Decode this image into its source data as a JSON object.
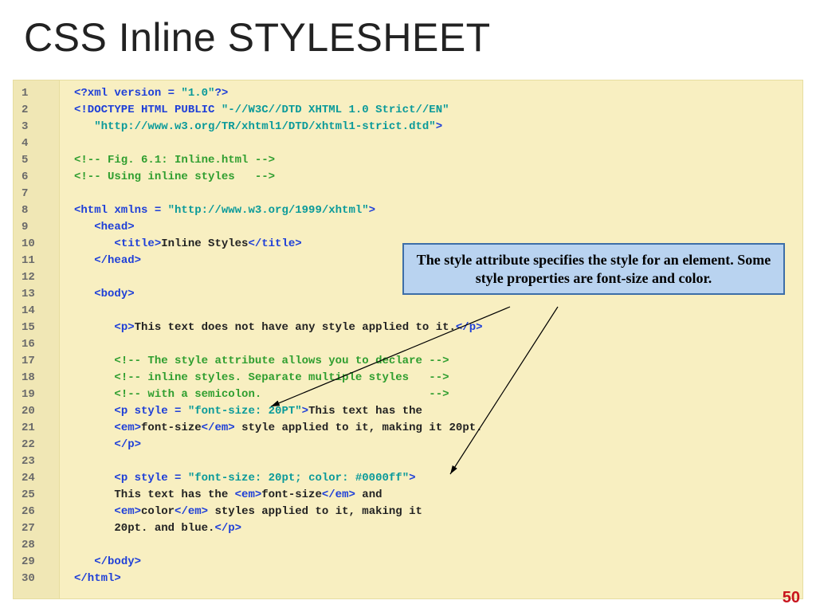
{
  "title": "CSS   Inline STYLESHEET",
  "callout": "The style attribute specifies the style for an element. Some style properties are font-size and color.",
  "page_number": "50",
  "code": {
    "lines": [
      {
        "n": "1",
        "segs": [
          {
            "t": "<?xml version = ",
            "c": "blue"
          },
          {
            "t": "\"1.0\"",
            "c": "str"
          },
          {
            "t": "?>",
            "c": "blue"
          }
        ]
      },
      {
        "n": "2",
        "segs": [
          {
            "t": "<!DOCTYPE HTML PUBLIC ",
            "c": "blue"
          },
          {
            "t": "\"-//W3C//DTD XHTML 1.0 Strict//EN\"",
            "c": "str"
          }
        ]
      },
      {
        "n": "3",
        "segs": [
          {
            "t": "   ",
            "c": ""
          },
          {
            "t": "\"http://www.w3.org/TR/xhtml1/DTD/xhtml1-strict.dtd\"",
            "c": "str"
          },
          {
            "t": ">",
            "c": "blue"
          }
        ]
      },
      {
        "n": "4",
        "segs": [
          {
            "t": "",
            "c": ""
          }
        ]
      },
      {
        "n": "5",
        "segs": [
          {
            "t": "<!-- Fig. 6.1: Inline.html -->",
            "c": "cmt"
          }
        ]
      },
      {
        "n": "6",
        "segs": [
          {
            "t": "<!-- Using inline styles   -->",
            "c": "cmt"
          }
        ]
      },
      {
        "n": "7",
        "segs": [
          {
            "t": "",
            "c": ""
          }
        ]
      },
      {
        "n": "8",
        "segs": [
          {
            "t": "<html xmlns = ",
            "c": "blue"
          },
          {
            "t": "\"http://www.w3.org/1999/xhtml\"",
            "c": "str"
          },
          {
            "t": ">",
            "c": "blue"
          }
        ]
      },
      {
        "n": "9",
        "segs": [
          {
            "t": "   ",
            "c": ""
          },
          {
            "t": "<head>",
            "c": "blue"
          }
        ]
      },
      {
        "n": "10",
        "segs": [
          {
            "t": "      ",
            "c": ""
          },
          {
            "t": "<title>",
            "c": "blue"
          },
          {
            "t": "Inline Styles",
            "c": ""
          },
          {
            "t": "</title>",
            "c": "blue"
          }
        ]
      },
      {
        "n": "11",
        "segs": [
          {
            "t": "   ",
            "c": ""
          },
          {
            "t": "</head>",
            "c": "blue"
          }
        ]
      },
      {
        "n": "12",
        "segs": [
          {
            "t": "",
            "c": ""
          }
        ]
      },
      {
        "n": "13",
        "segs": [
          {
            "t": "   ",
            "c": ""
          },
          {
            "t": "<body>",
            "c": "blue"
          }
        ]
      },
      {
        "n": "14",
        "segs": [
          {
            "t": "",
            "c": ""
          }
        ]
      },
      {
        "n": "15",
        "segs": [
          {
            "t": "      ",
            "c": ""
          },
          {
            "t": "<p>",
            "c": "blue"
          },
          {
            "t": "This text does not have any style applied to it.",
            "c": ""
          },
          {
            "t": "</p>",
            "c": "blue"
          }
        ]
      },
      {
        "n": "16",
        "segs": [
          {
            "t": "",
            "c": ""
          }
        ]
      },
      {
        "n": "17",
        "segs": [
          {
            "t": "      ",
            "c": ""
          },
          {
            "t": "<!-- The style attribute allows you to declare -->",
            "c": "cmt"
          }
        ]
      },
      {
        "n": "18",
        "segs": [
          {
            "t": "      ",
            "c": ""
          },
          {
            "t": "<!-- inline styles. Separate multiple styles   -->",
            "c": "cmt"
          }
        ]
      },
      {
        "n": "19",
        "segs": [
          {
            "t": "      ",
            "c": ""
          },
          {
            "t": "<!-- with a semicolon.                         -->",
            "c": "cmt"
          }
        ]
      },
      {
        "n": "20",
        "segs": [
          {
            "t": "      ",
            "c": ""
          },
          {
            "t": "<p style = ",
            "c": "blue"
          },
          {
            "t": "\"font-size: 20PT\"",
            "c": "str"
          },
          {
            "t": ">",
            "c": "blue"
          },
          {
            "t": "This text has the",
            "c": ""
          }
        ]
      },
      {
        "n": "21",
        "segs": [
          {
            "t": "      ",
            "c": ""
          },
          {
            "t": "<em>",
            "c": "blue"
          },
          {
            "t": "font-size",
            "c": ""
          },
          {
            "t": "</em>",
            "c": "blue"
          },
          {
            "t": " style applied to it, making it 20pt.",
            "c": ""
          }
        ]
      },
      {
        "n": "22",
        "segs": [
          {
            "t": "      ",
            "c": ""
          },
          {
            "t": "</p>",
            "c": "blue"
          }
        ]
      },
      {
        "n": "23",
        "segs": [
          {
            "t": "",
            "c": ""
          }
        ]
      },
      {
        "n": "24",
        "segs": [
          {
            "t": "      ",
            "c": ""
          },
          {
            "t": "<p style = ",
            "c": "blue"
          },
          {
            "t": "\"font-size: 20pt; color: #0000ff\"",
            "c": "str"
          },
          {
            "t": ">",
            "c": "blue"
          }
        ]
      },
      {
        "n": "25",
        "segs": [
          {
            "t": "      This text has the ",
            "c": ""
          },
          {
            "t": "<em>",
            "c": "blue"
          },
          {
            "t": "font-size",
            "c": ""
          },
          {
            "t": "</em>",
            "c": "blue"
          },
          {
            "t": " and",
            "c": ""
          }
        ]
      },
      {
        "n": "26",
        "segs": [
          {
            "t": "      ",
            "c": ""
          },
          {
            "t": "<em>",
            "c": "blue"
          },
          {
            "t": "color",
            "c": ""
          },
          {
            "t": "</em>",
            "c": "blue"
          },
          {
            "t": " styles applied to it, making it",
            "c": ""
          }
        ]
      },
      {
        "n": "27",
        "segs": [
          {
            "t": "      20pt. and blue.",
            "c": ""
          },
          {
            "t": "</p>",
            "c": "blue"
          }
        ]
      },
      {
        "n": "28",
        "segs": [
          {
            "t": "",
            "c": ""
          }
        ]
      },
      {
        "n": "29",
        "segs": [
          {
            "t": "   ",
            "c": ""
          },
          {
            "t": "</body>",
            "c": "blue"
          }
        ]
      },
      {
        "n": "30",
        "segs": [
          {
            "t": "",
            "c": ""
          },
          {
            "t": "</html>",
            "c": "blue"
          }
        ]
      }
    ]
  }
}
